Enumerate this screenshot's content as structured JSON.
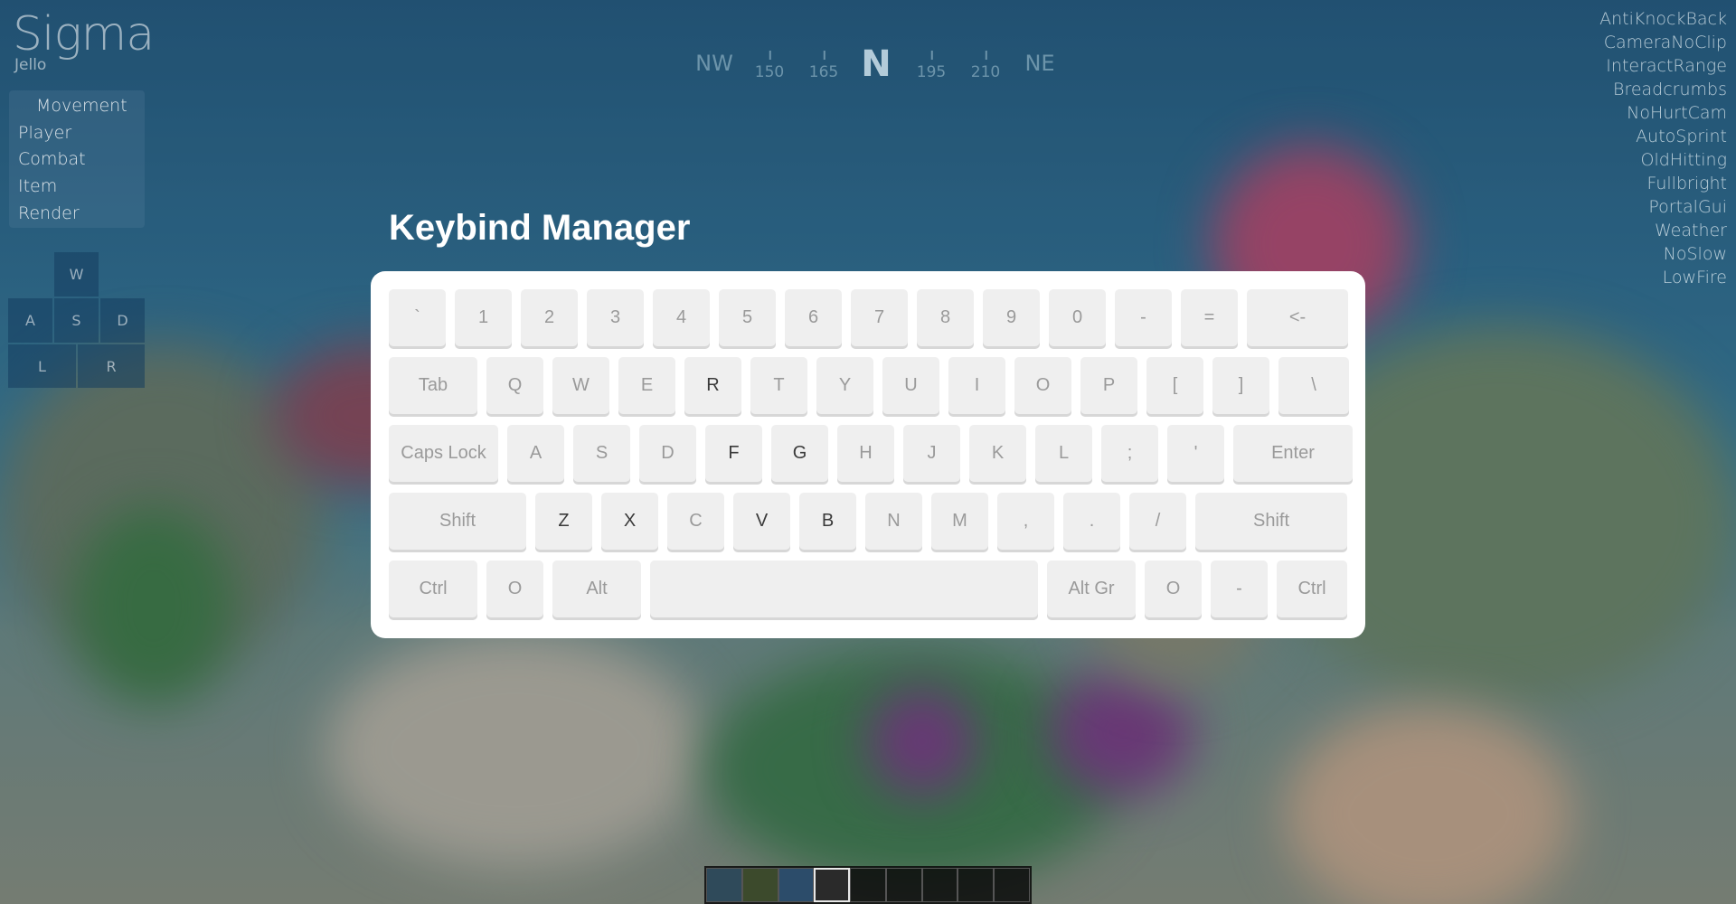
{
  "logo": {
    "title": "Sigma",
    "subtitle": "Jello"
  },
  "categories": [
    "Movement",
    "Player",
    "Combat",
    "Item",
    "Render"
  ],
  "keystrokes": {
    "w": "W",
    "a": "A",
    "s": "S",
    "d": "D",
    "l": "L",
    "r": "R"
  },
  "compass": {
    "left_dir": "NW",
    "n1": "150",
    "n2": "165",
    "center": "N",
    "n3": "195",
    "n4": "210",
    "right_dir": "NE"
  },
  "modules": [
    "AntiKnockBack",
    "CameraNoClip",
    "InteractRange",
    "Breadcrumbs",
    "NoHurtCam",
    "AutoSprint",
    "OldHitting",
    "Fullbright",
    "PortalGui",
    "Weather",
    "NoSlow",
    "LowFire"
  ],
  "keybind_manager": {
    "title": "Keybind Manager",
    "rows": [
      [
        "`",
        "1",
        "2",
        "3",
        "4",
        "5",
        "6",
        "7",
        "8",
        "9",
        "0",
        "-",
        "=",
        "<-"
      ],
      [
        "Tab",
        "Q",
        "W",
        "E",
        "R",
        "T",
        "Y",
        "U",
        "I",
        "O",
        "P",
        "[",
        "]",
        "\\"
      ],
      [
        "Caps Lock",
        "A",
        "S",
        "D",
        "F",
        "G",
        "H",
        "J",
        "K",
        "L",
        ";",
        "'",
        "Enter"
      ],
      [
        "Shift",
        "Z",
        "X",
        "C",
        "V",
        "B",
        "N",
        "M",
        ",",
        ".",
        "/",
        "Shift"
      ],
      [
        "Ctrl",
        "O",
        "Alt",
        "",
        "Alt Gr",
        "O",
        "-",
        "Ctrl"
      ]
    ],
    "bound_keys": [
      "R",
      "F",
      "G",
      "Z",
      "X",
      "V",
      "B"
    ]
  },
  "hotbar": {
    "slot_count": 9,
    "selected_index": 3
  }
}
